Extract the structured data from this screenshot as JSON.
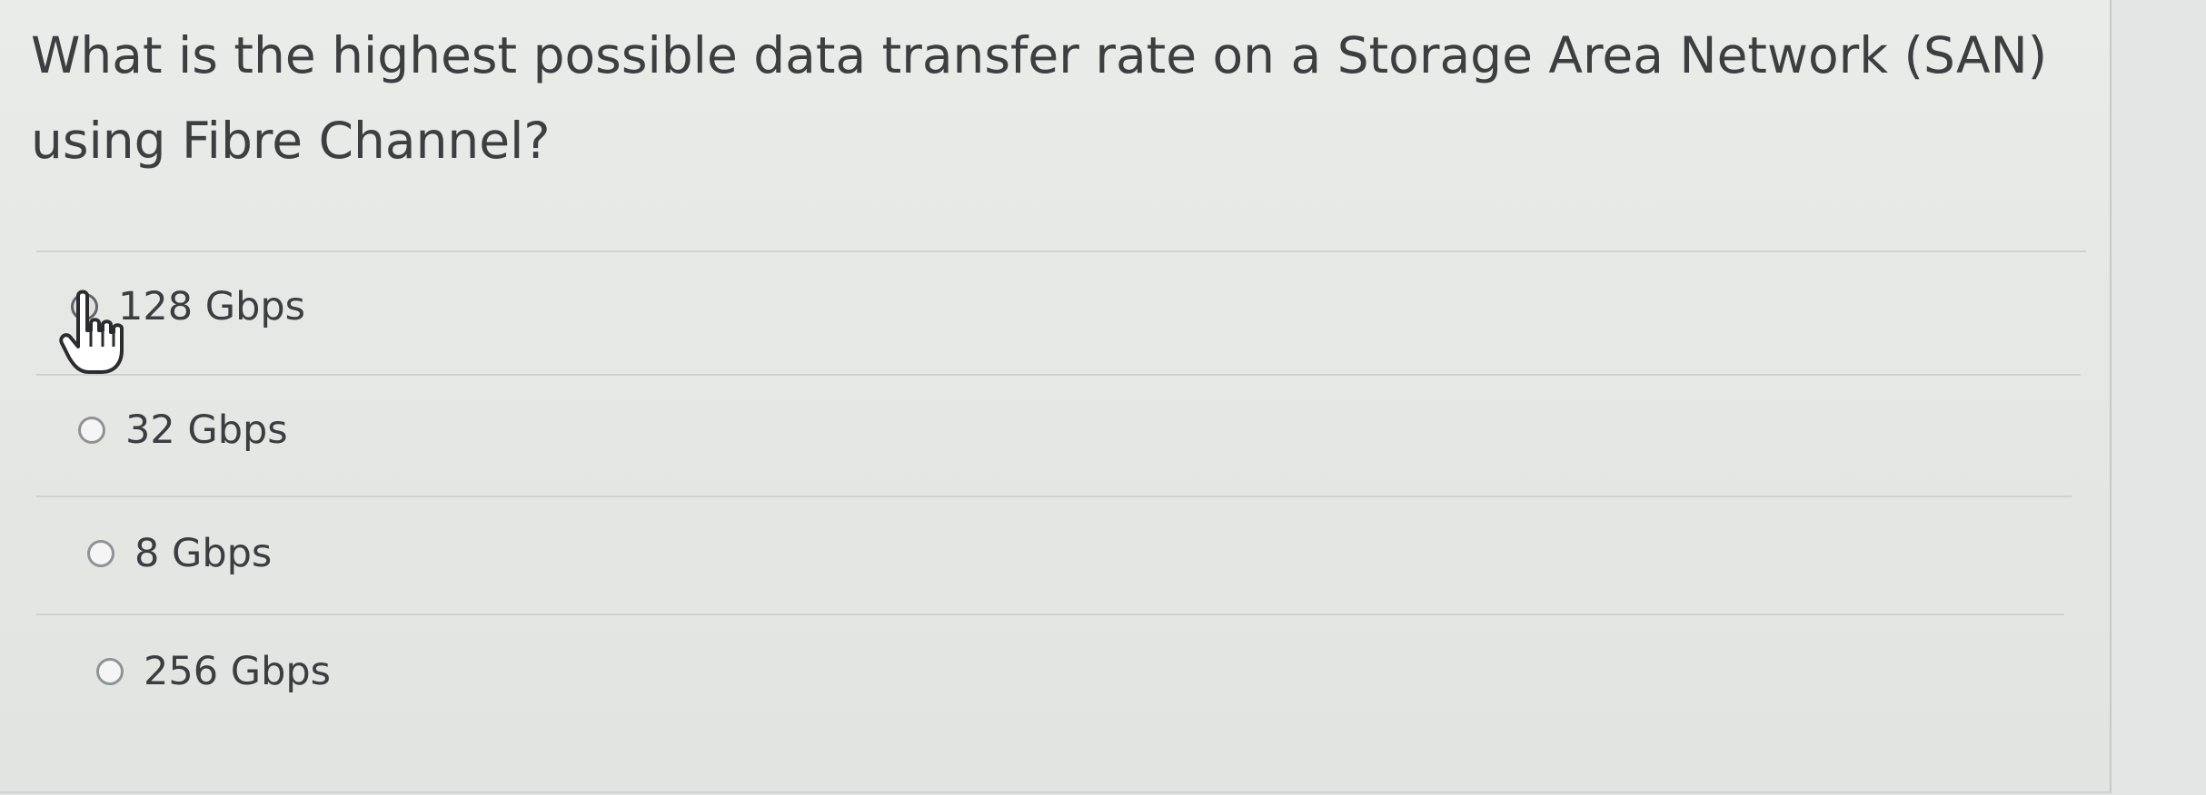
{
  "question": {
    "text": "What is the highest possible data transfer rate on a Storage Area Network (SAN) using Fibre Channel?"
  },
  "options": [
    {
      "label": "128 Gbps",
      "selected": false,
      "hovered": true
    },
    {
      "label": "32 Gbps",
      "selected": false,
      "hovered": false
    },
    {
      "label": "8 Gbps",
      "selected": false,
      "hovered": false
    },
    {
      "label": "256 Gbps",
      "selected": false,
      "hovered": false
    }
  ],
  "cursor": {
    "icon": "hand-pointer-icon"
  },
  "colors": {
    "background": "#e6e8e6",
    "text": "#3c3e40",
    "divider": "#cfd2d1",
    "radio_border": "#8f9396"
  }
}
